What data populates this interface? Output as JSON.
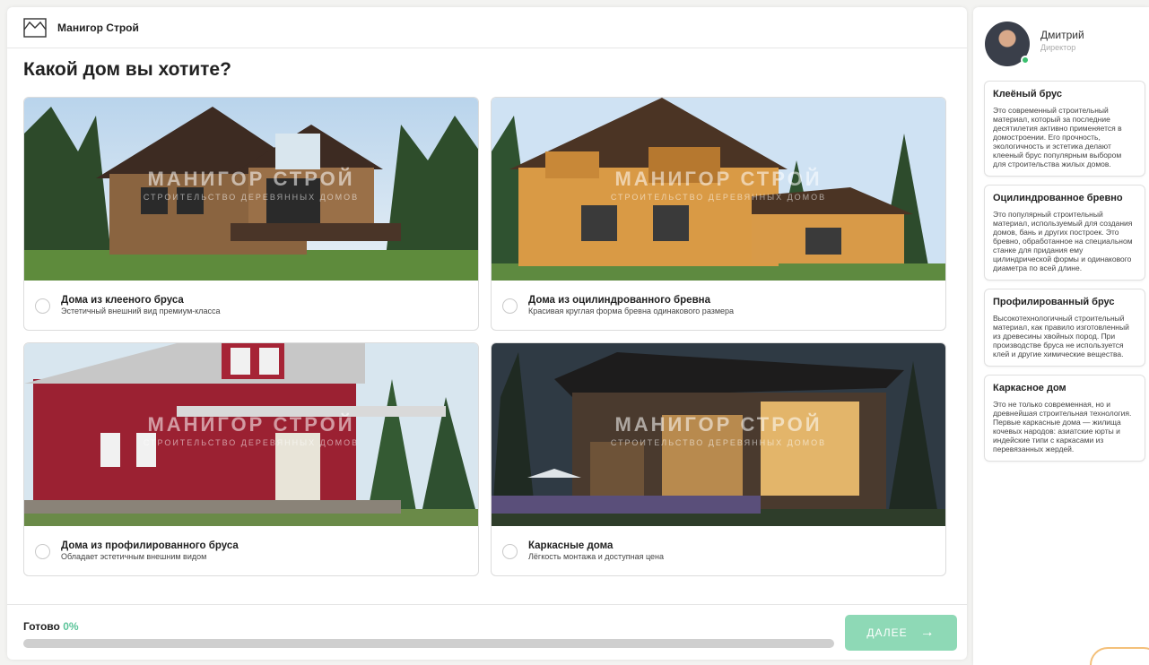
{
  "company": {
    "name": "Манигор Строй",
    "logo_icon": "house-logo-icon"
  },
  "question": "Какой дом вы хотите?",
  "watermark": {
    "title": "МАНИГОР СТРОЙ",
    "subtitle": "СТРОИТЕЛЬСТВО ДЕРЕВЯННЫХ ДОМОВ"
  },
  "options": [
    {
      "title": "Дома из клееного бруса",
      "subtitle": "Эстетичный внешний вид премиум-класса",
      "image_color": "#7a5a3a"
    },
    {
      "title": "Дома из оцилиндрованного бревна",
      "subtitle": "Красивая круглая форма бревна одинакового размера",
      "image_color": "#c98a3a"
    },
    {
      "title": "Дома из профилированного бруса",
      "subtitle": "Обладает эстетичным внешним видом",
      "image_color": "#9a2030"
    },
    {
      "title": "Каркасные дома",
      "subtitle": "Лёгкость монтажа и доступная цена",
      "image_color": "#3a3028"
    }
  ],
  "progress": {
    "label": "Готово",
    "value_text": "0%",
    "value": 0
  },
  "next_button": {
    "label": "ДАЛЕЕ",
    "icon": "arrow-right-icon"
  },
  "manager": {
    "name": "Дмитрий",
    "role": "Директор"
  },
  "tips": [
    {
      "title": "Клеёный брус",
      "text": "Это современный строительный материал, который за последние десятилетия активно применяется в домостроении. Его прочность, экологичность и эстетика делают клееный брус популярным выбором для строительства жилых домов."
    },
    {
      "title": "Оцилиндрованное бревно",
      "text": "Это популярный строительный материал, используемый для создания домов, бань и других построек. Это бревно, обработанное на специальном станке для придания ему цилиндрической формы и одинакового диаметра по всей длине."
    },
    {
      "title": "Профилированный брус",
      "text": "Высокотехнологичный строительный материал, как правило изготовленный из древесины хвойных пород. При производстве бруса не используется клей и другие химические вещества."
    },
    {
      "title": "Каркасное дом",
      "text": "Это не только современная, но и древнейшая строительная технология. Первые каркасные дома — жилища кочевых народов: азиатские юрты и индейские типи с каркасами из перевязанных жердей."
    }
  ],
  "colors": {
    "accent": "#5cc49a",
    "button": "#8ed9b6",
    "track": "#cfcfcf"
  }
}
